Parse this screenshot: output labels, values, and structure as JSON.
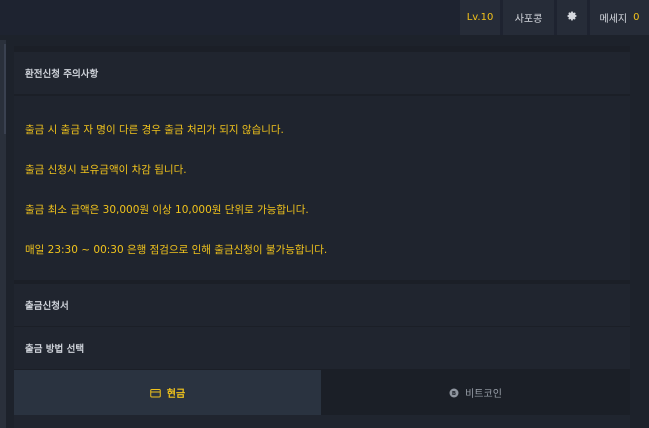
{
  "header": {
    "level": "Lv.10",
    "support": "사포콩",
    "message_label": "메세지",
    "message_count": "0"
  },
  "notice": {
    "title": "환전신청 주의사항",
    "lines": [
      "출금 시 출금 자 명이 다른 경우 출금 처리가 되지 않습니다.",
      "출금 신청시 보유금액이 차감 됩니다.",
      "출금 최소 금액은 30,000원 이상 10,000원 단위로 가능합니다.",
      "매일 23:30 ~ 00:30 은행 점검으로 인해 출금신청이 불가능합니다."
    ]
  },
  "form": {
    "title": "출금신청서",
    "method_label": "출금 방법 선택",
    "tabs": [
      {
        "label": "현금",
        "icon": "wallet-icon",
        "active": true
      },
      {
        "label": "비트코인",
        "icon": "bitcoin-icon",
        "active": false
      }
    ]
  },
  "colors": {
    "accent": "#f0c31c",
    "background": "#1d222b"
  }
}
